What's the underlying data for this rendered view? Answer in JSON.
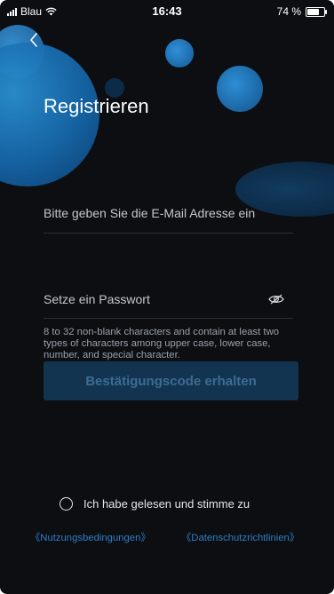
{
  "status_bar": {
    "carrier": "Blau",
    "time": "16:43",
    "battery_percent": "74 %",
    "battery_level": 0.74
  },
  "header": {
    "back_icon": "chevron-left-icon",
    "title": "Registrieren"
  },
  "form": {
    "email_placeholder": "Bitte geben Sie die E-Mail Adresse ein",
    "password_placeholder": "Setze ein Passwort",
    "password_toggle_icon": "eye-off-icon",
    "password_hint": "8 to 32 non-blank characters and contain at least two types of characters among upper case, lower case, number, and special character.",
    "submit_label": "Bestätigungscode erhalten"
  },
  "agreement": {
    "checkbox_icon": "radio-circle-icon",
    "checked": false,
    "text": "Ich habe gelesen und stimme zu",
    "terms_link": "《Nutzungsbedingungen》",
    "privacy_link": "《Datenschutzrichtlinien》"
  },
  "colors": {
    "background": "#0c0e12",
    "accent": "#2f7fc4",
    "button_bg": "#123450",
    "button_text": "#3c6c93"
  }
}
